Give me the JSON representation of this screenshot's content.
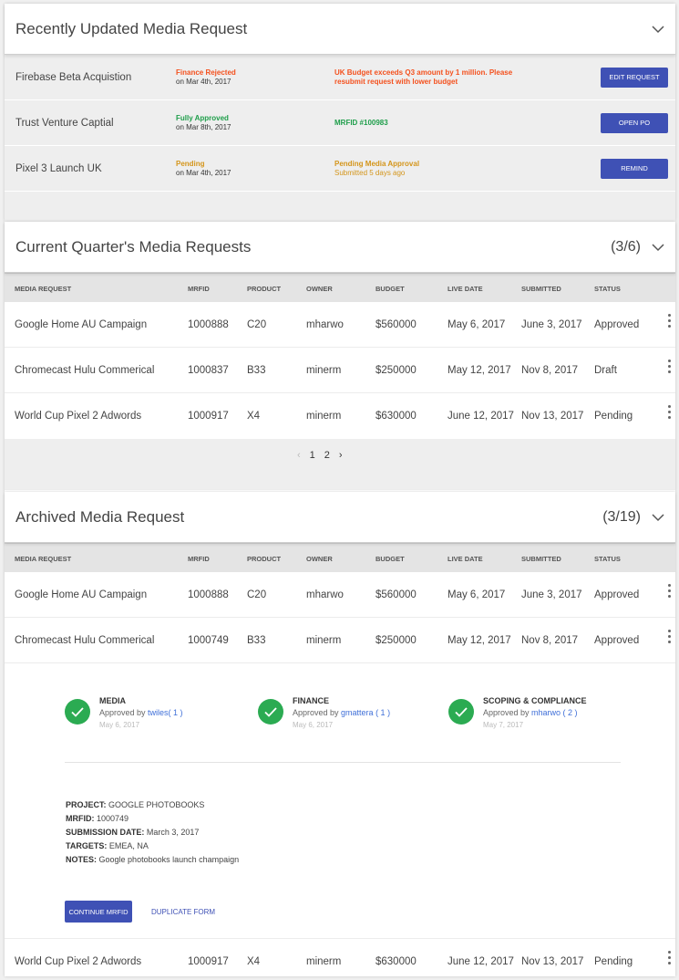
{
  "recent": {
    "title": "Recently Updated Media Request",
    "rows": [
      {
        "name": "Firebase Beta Acquistion",
        "status": "Finance Rejected",
        "date": "on Mar 4th, 2017",
        "note": "UK Budget exceeds Q3 amount by 1 million. Please resubmit request with lower budget",
        "note_sub": "",
        "button": "EDIT REQUEST",
        "color": "#f4511e"
      },
      {
        "name": "Trust Venture Captial",
        "status": "Fully Approved",
        "date": "on Mar 8th, 2017",
        "note": "MRFID #100983",
        "note_sub": "",
        "button": "OPEN PO",
        "color": "#1e9e4a"
      },
      {
        "name": "Pixel 3 Launch UK",
        "status": "Pending",
        "date": "on Mar 4th, 2017",
        "note": "Pending Media Approval",
        "note_sub": "Submitted 5 days ago",
        "button": "REMIND",
        "color": "#d4951a"
      }
    ]
  },
  "current": {
    "title": "Current Quarter's Media Requests",
    "count": "(3/6)",
    "columns": [
      "MEDIA REQUEST",
      "MRFID",
      "PRODUCT",
      "OWNER",
      "BUDGET",
      "LIVE DATE",
      "SUBMITTED",
      "STATUS"
    ],
    "rows": [
      [
        "Google Home AU Campaign",
        "1000888",
        "C20",
        "mharwo",
        "$560000",
        "May 6, 2017",
        "June 3, 2017",
        "Approved"
      ],
      [
        "Chromecast Hulu Commerical",
        "1000837",
        "B33",
        "minerm",
        "$250000",
        "May 12, 2017",
        "Nov 8, 2017",
        "Draft"
      ],
      [
        "World Cup Pixel 2 Adwords",
        "1000917",
        "X4",
        "minerm",
        "$630000",
        "June 12, 2017",
        "Nov 13, 2017",
        "Pending"
      ]
    ],
    "pager": {
      "prev": "‹",
      "p1": "1",
      "p2": "2",
      "next": "›"
    }
  },
  "archived": {
    "title": "Archived Media Request",
    "count": "(3/19)",
    "columns": [
      "MEDIA REQUEST",
      "MRFID",
      "PRODUCT",
      "OWNER",
      "BUDGET",
      "LIVE DATE",
      "SUBMITTED",
      "STATUS"
    ],
    "rows": [
      [
        "Google Home AU Campaign",
        "1000888",
        "C20",
        "mharwo",
        "$560000",
        "May 6, 2017",
        "June 3, 2017",
        "Approved"
      ],
      [
        "Chromecast Hulu Commerical",
        "1000749",
        "B33",
        "minerm",
        "$250000",
        "May 12, 2017",
        "Nov 8, 2017",
        "Approved"
      ],
      [
        "World Cup Pixel 2 Adwords",
        "1000917",
        "X4",
        "minerm",
        "$630000",
        "June 12, 2017",
        "Nov 13, 2017",
        "Pending"
      ]
    ],
    "detail": {
      "approvals": [
        {
          "title": "MEDIA",
          "by": "Approved by ",
          "user": "twiles( 1 )",
          "date": "May 6, 2017"
        },
        {
          "title": "FINANCE",
          "by": "Approved by ",
          "user": "gmattera ( 1 )",
          "date": "May 6, 2017"
        },
        {
          "title": "SCOPING & COMPLIANCE",
          "by": "Approved by ",
          "user": "mharwo ( 2 )",
          "date": "May 7, 2017"
        }
      ],
      "project_label": "PROJECT:",
      "project": "GOOGLE PHOTOBOOKS",
      "mrfid_label": "MRFID:",
      "mrfid": "1000749",
      "submission_label": "SUBMISSION DATE:",
      "submission": "March 3, 2017",
      "targets_label": "TARGETS:",
      "targets": "EMEA, NA",
      "notes_label": "NOTES:",
      "notes": "Google photobooks launch champaign",
      "continue_label": "CONTINUE MRFID",
      "duplicate_label": "DUPLICATE FORM"
    }
  }
}
